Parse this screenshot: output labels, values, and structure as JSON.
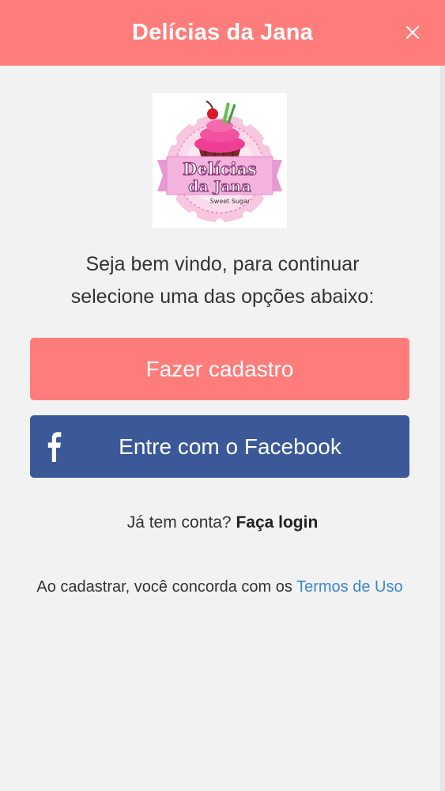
{
  "header": {
    "title": "Delícias da Jana",
    "close_icon": "close-icon",
    "background": "#fe7d7b"
  },
  "logo": {
    "line1": "Delícias",
    "line2": "da Jana",
    "tagline": "Sweet Sugar"
  },
  "welcome": {
    "line1": "Seja bem vindo, para continuar",
    "line2": "selecione uma das opções abaixo:"
  },
  "buttons": {
    "signup_label": "Fazer cadastro",
    "facebook_label": "Entre com o Facebook",
    "facebook_icon": "facebook-icon",
    "signup_color": "#fe7d7b",
    "facebook_color": "#3b5998"
  },
  "login": {
    "prompt": "Já tem conta?",
    "link": "Faça login"
  },
  "terms": {
    "text": "Ao cadastrar, você concorda com os",
    "link": "Termos de Uso",
    "link_color": "#3a87d1"
  }
}
